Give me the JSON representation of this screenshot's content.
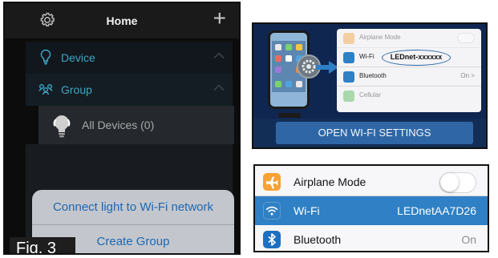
{
  "app": {
    "title": "Home",
    "sections": [
      {
        "label": "Device"
      },
      {
        "label": "Group"
      }
    ],
    "all_devices_label": "All Devices (0)",
    "action_sheet": {
      "connect_label": "Connect light to Wi-Fi network",
      "create_group_label": "Create Group"
    },
    "figure_label": "Fig. 3"
  },
  "illustration": {
    "rows": [
      {
        "label": "Airplane Mode",
        "color": "#f0a13a"
      },
      {
        "label": "Wi-Fi",
        "value": "LEDnet-xxxxxx",
        "color": "#2f80c4"
      },
      {
        "label": "Bluetooth",
        "value": "On >",
        "color": "#2f80c4"
      },
      {
        "label": "Cellular",
        "color": "#4fb84f"
      }
    ],
    "open_button_label": "OPEN WI-FI SETTINGS"
  },
  "settings": {
    "rows": [
      {
        "label": "Airplane Mode",
        "icon": "airplane-icon",
        "color": "#f7a233"
      },
      {
        "label": "Wi-Fi",
        "value": "LEDnetAA7D26",
        "icon": "wifi-icon",
        "color": "#2f80c4"
      },
      {
        "label": "Bluetooth",
        "value": "On",
        "icon": "bluetooth-icon",
        "color": "#1d6fc1"
      }
    ],
    "airplane_mode_on": false
  },
  "colors": {
    "accent": "#3ea6c8",
    "link": "#1c67b3",
    "highlight": "#2f80c4"
  }
}
